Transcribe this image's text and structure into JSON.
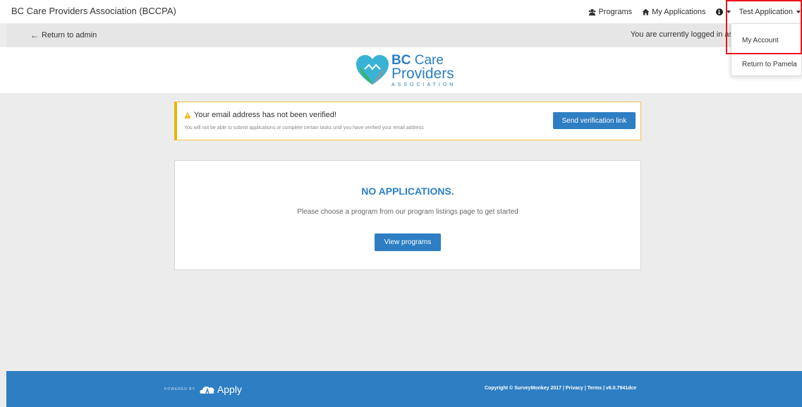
{
  "topbar": {
    "org_title": "BC Care Providers Association (BCCPA)",
    "nav": {
      "programs_label": "Programs",
      "programs_icon": "users-icon",
      "applications_label": "My Applications",
      "applications_icon": "home-icon",
      "info_icon": "info-icon",
      "user_label": "Test Application"
    }
  },
  "subbar": {
    "return_label": "Return to admin",
    "logged_in_text": "You are currently logged in as"
  },
  "logo": {
    "bc": "BC",
    "care": "Care",
    "providers": "Providers",
    "association": "ASSOCIATION",
    "colors": {
      "blue": "#2a7fc4",
      "green": "#3bb54a",
      "teal": "#39b3d4"
    }
  },
  "alert": {
    "title": "Your email address has not been verified!",
    "description": "You will not be able to submit applications or complete certain tasks until you have verified your email address",
    "button_label": "Send verification link",
    "icon": "warning-icon",
    "accent": "#f0b400"
  },
  "main": {
    "heading": "NO APPLICATIONS.",
    "text": "Please choose a program from our program listings page to get started",
    "button_label": "View programs"
  },
  "footer": {
    "powered_by": "POWERED BY",
    "brand": "Apply",
    "copyright": "Copyright © SurveyMonkey 2017 | Privacy | Terms | v6.0.7941dce"
  },
  "user_menu": {
    "items": [
      {
        "label": "My Account"
      },
      {
        "label": "Return to Pamela"
      }
    ]
  },
  "colors": {
    "primary": "#2e7ec3",
    "highlight": "#e8161d"
  }
}
